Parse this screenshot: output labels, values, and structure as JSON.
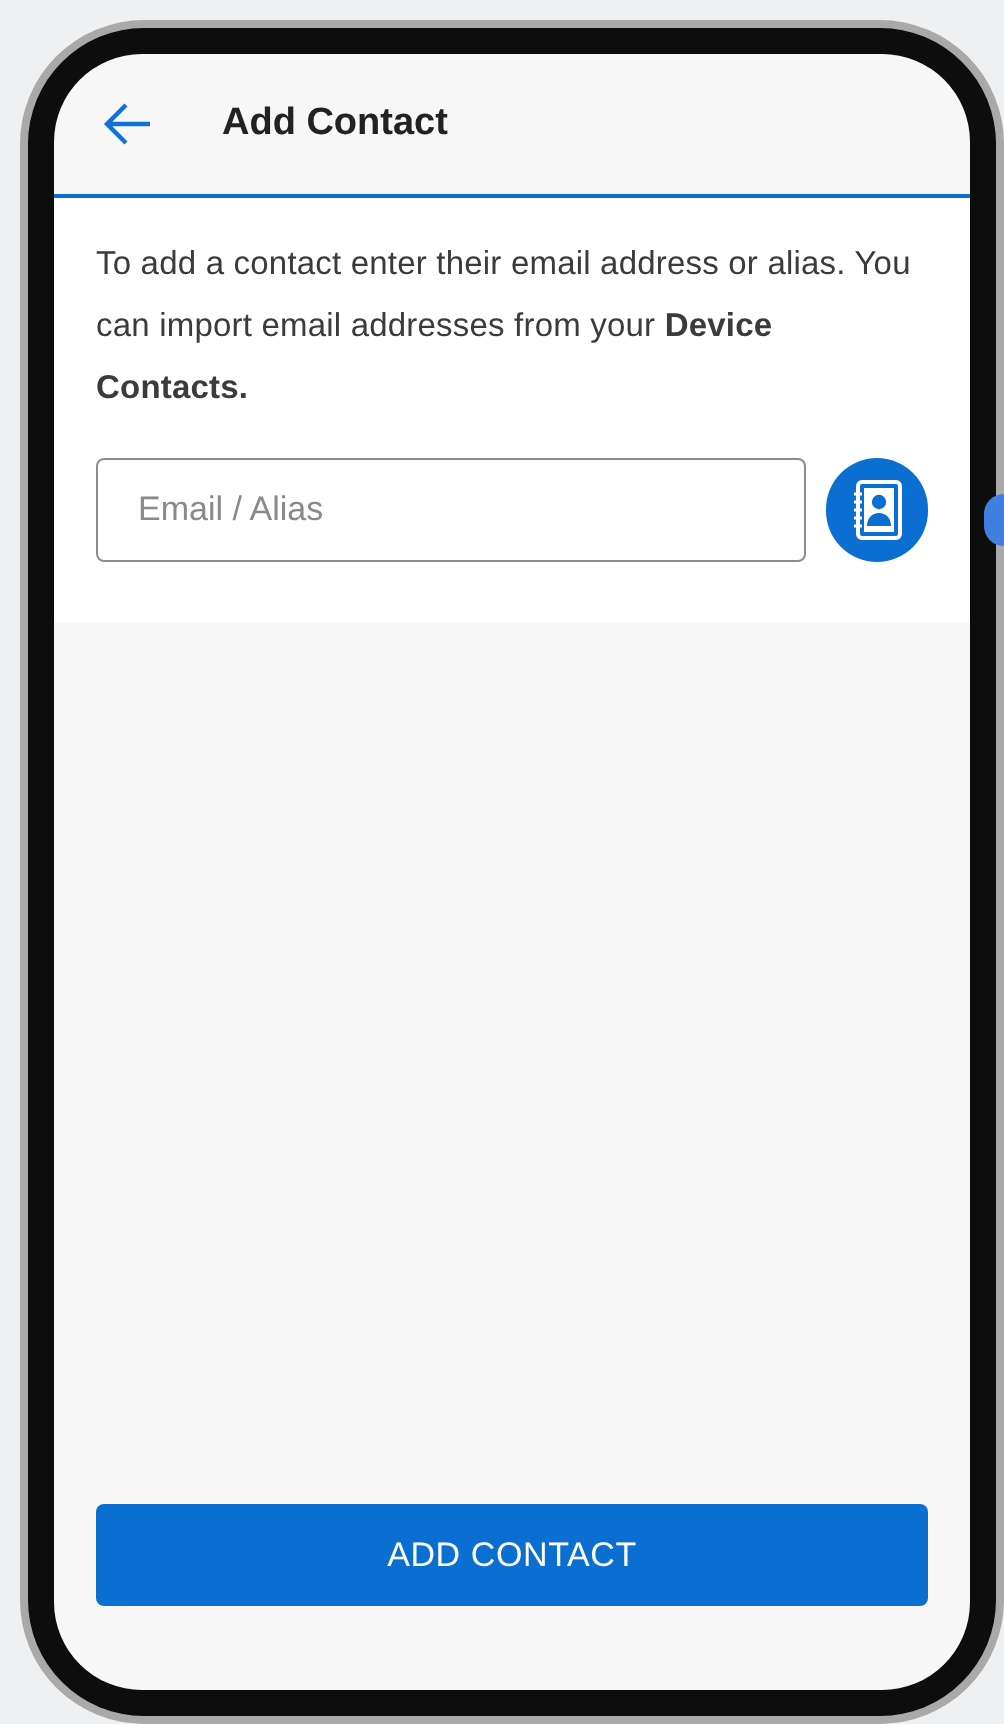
{
  "header": {
    "title": "Add Contact"
  },
  "intro": "To add a contact enter their email address or alias. You can import email addresses from your **Device Contacts.**",
  "email_field": {
    "placeholder": "Email / Alias"
  },
  "primary_button": {
    "label": "ADD CONTACT"
  }
}
